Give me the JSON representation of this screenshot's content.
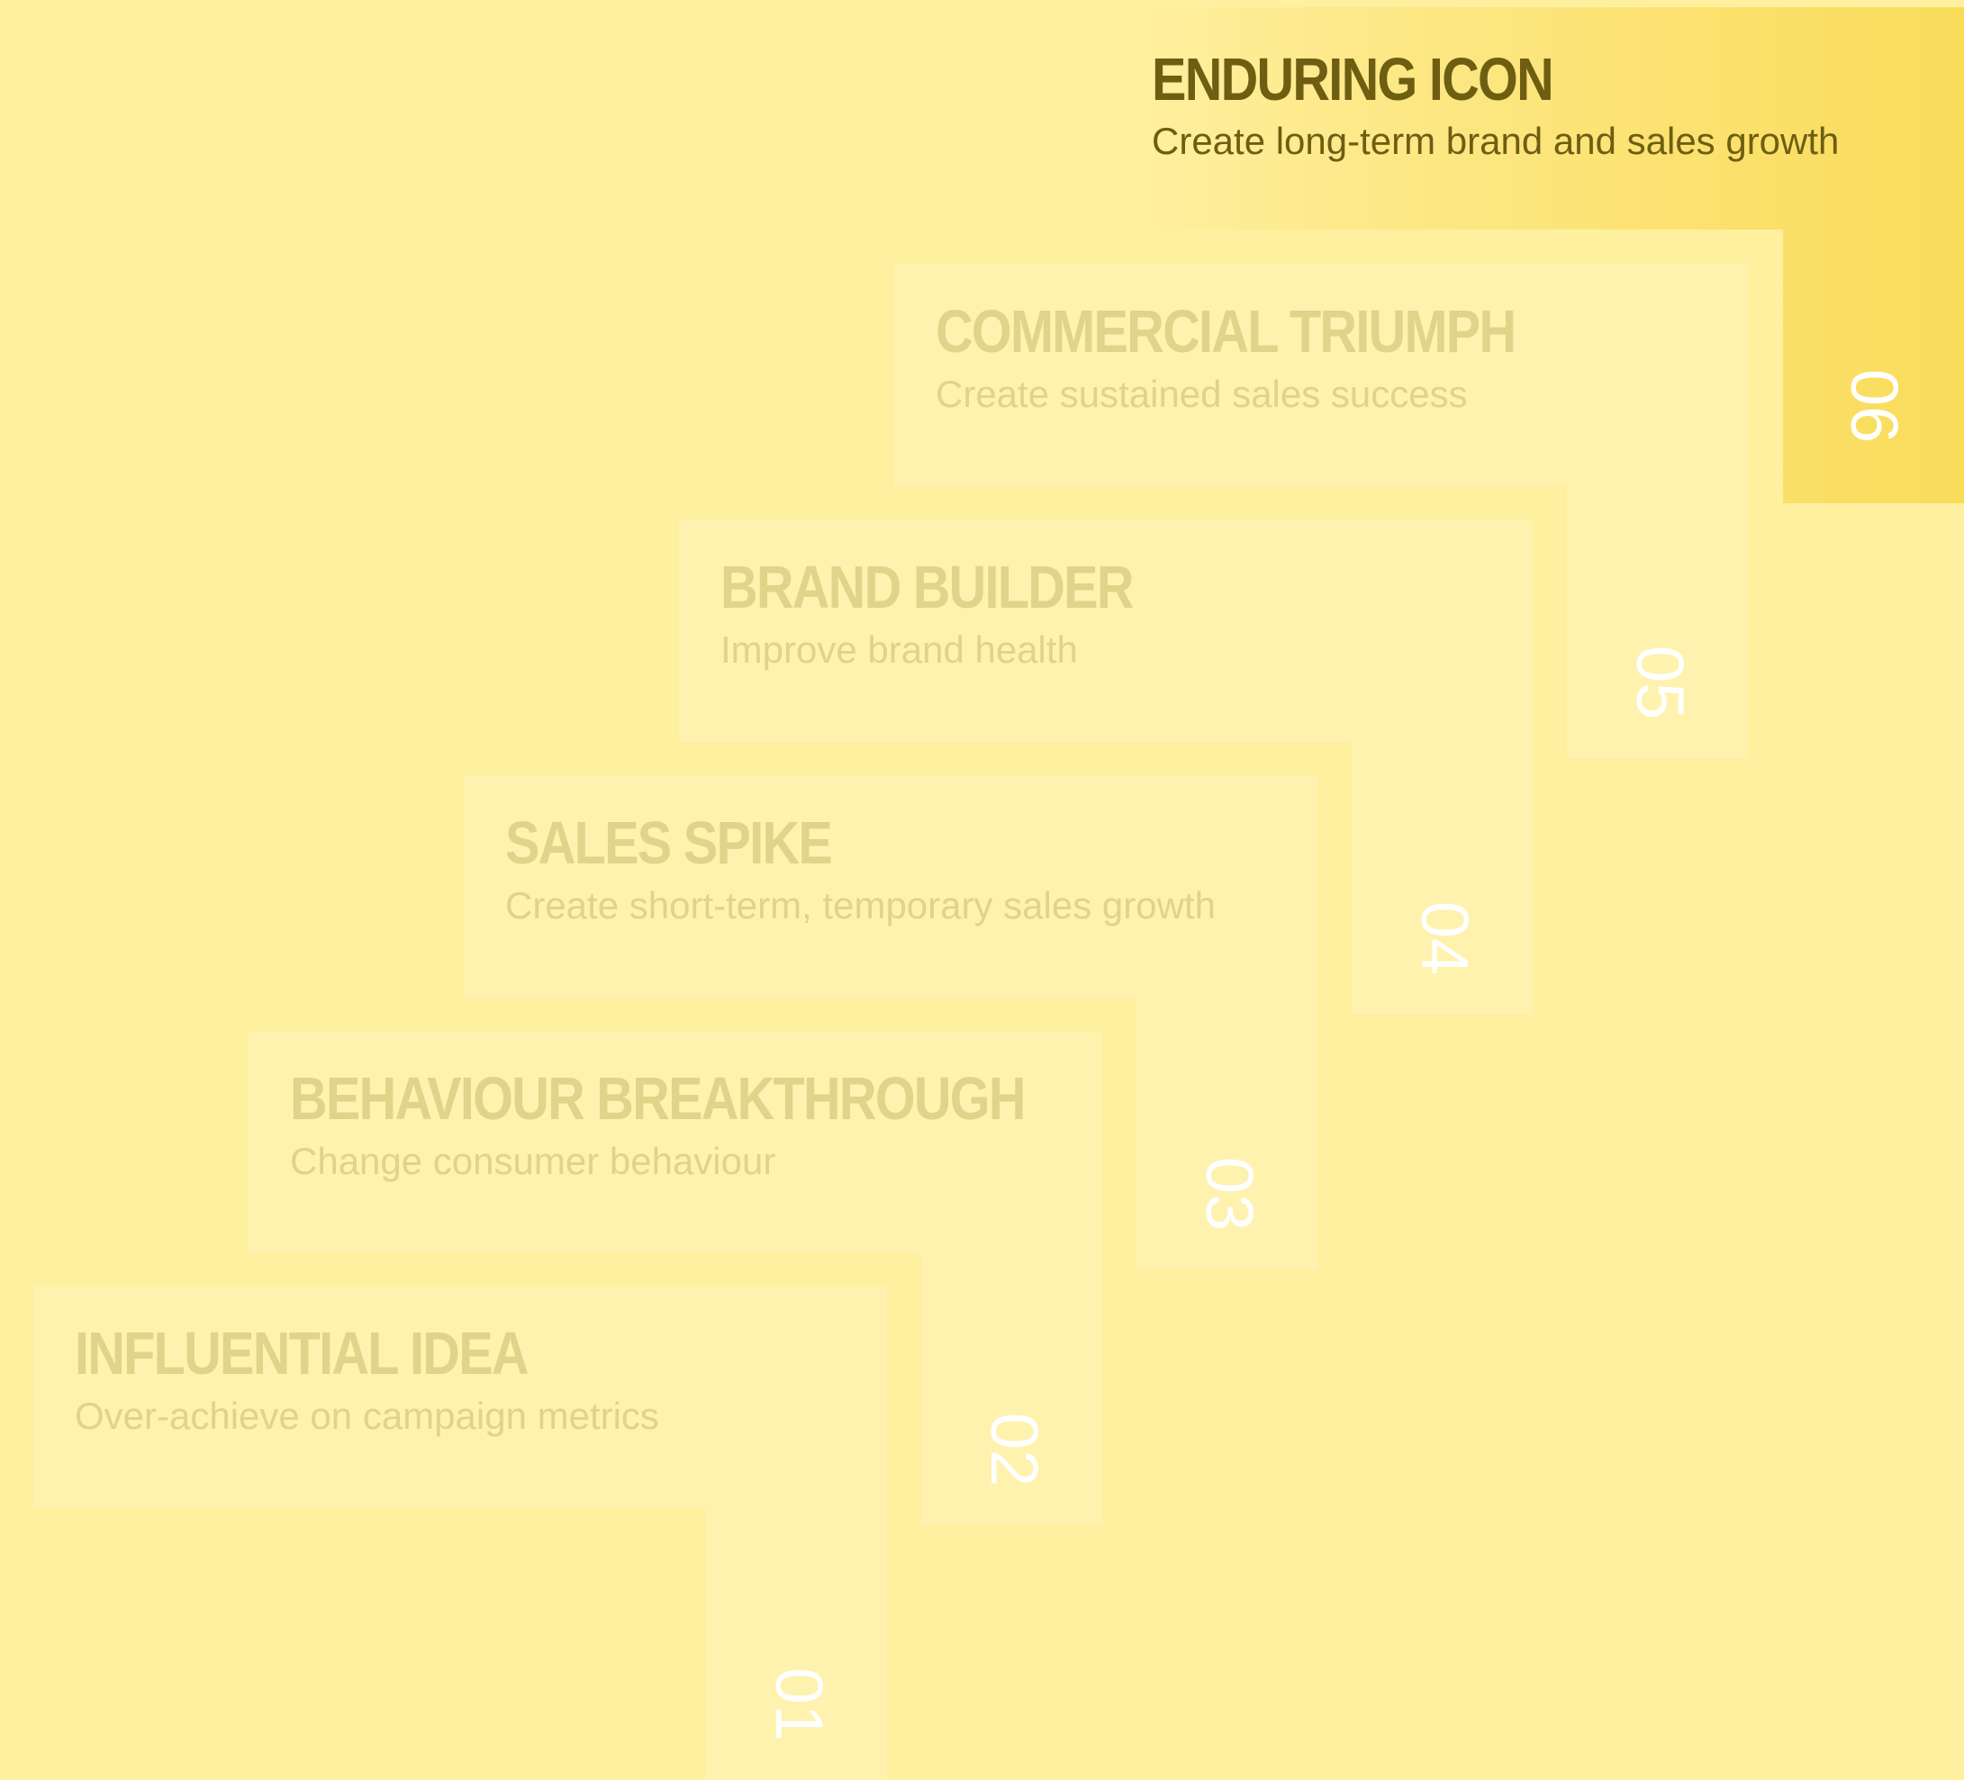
{
  "steps": [
    {
      "number": "01",
      "title": "INFLUENTIAL IDEA",
      "subtitle": "Over-achieve on campaign metrics"
    },
    {
      "number": "02",
      "title": "BEHAVIOUR BREAKTHROUGH",
      "subtitle": "Change consumer behaviour"
    },
    {
      "number": "03",
      "title": "SALES SPIKE",
      "subtitle": "Create short-term, temporary sales growth"
    },
    {
      "number": "04",
      "title": "BRAND BUILDER",
      "subtitle": "Improve brand health"
    },
    {
      "number": "05",
      "title": "COMMERCIAL TRIUMPH",
      "subtitle": "Create sustained sales success"
    },
    {
      "number": "06",
      "title": "ENDURING ICON",
      "subtitle": "Create long-term brand and sales growth"
    }
  ],
  "colors": {
    "background": "#fff0a0",
    "step_fill": "#fef2ae",
    "active_fill": "#f8dc5a",
    "muted_text": "#e0d38a",
    "active_text": "#6e5e12",
    "number_text": "#ffffff"
  }
}
